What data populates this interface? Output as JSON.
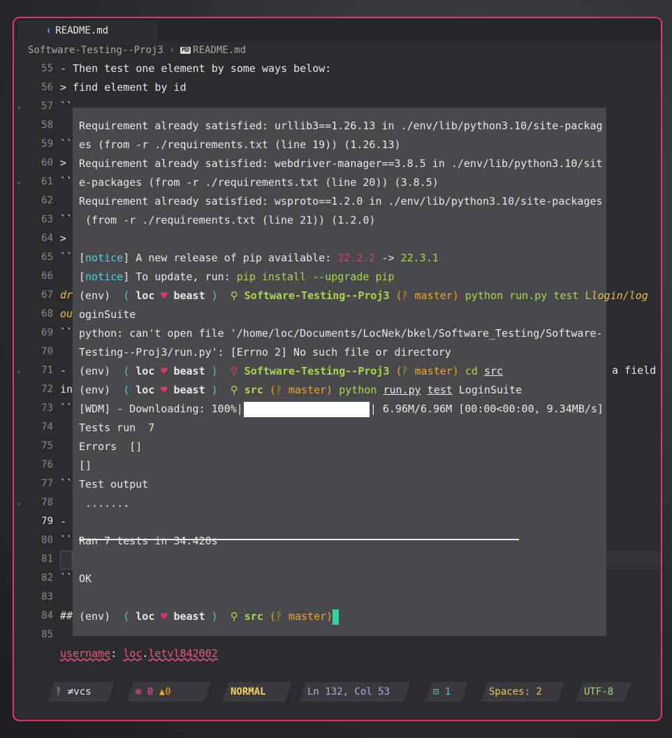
{
  "tab": {
    "label": "README.md"
  },
  "breadcrumb": {
    "folder": "Software-Testing--Proj3",
    "md_badge": "MD",
    "file": "README.md"
  },
  "gutter": [
    "55",
    "56",
    "57",
    "58",
    "59",
    "60",
    "61",
    "62",
    "63",
    "64",
    "65",
    "66",
    "67",
    "68",
    "69",
    "70",
    "71",
    "72",
    "73",
    "74",
    "75",
    "76",
    "77",
    "78",
    "79",
    "80",
    "81",
    "82",
    "83",
    "84",
    "85"
  ],
  "editor": {
    "l55": "- Then test one element by some ways below:",
    "l56": "> find element by id",
    "l57": "``",
    "l59": "``",
    "l60": ">",
    "l61": "``",
    "l63": "``",
    "l64": ">",
    "l65": "``",
    "l67": "dr",
    "l67b": "ou",
    "l68": "``",
    "l70": "-",
    "l70_right": "a field",
    "l70b": "in",
    "l71": "``",
    "l75": "``",
    "l77": "-",
    "l78": "``",
    "l80": "``",
    "l82": "##",
    "l84_key": "username",
    "l84_colon": ": ",
    "l84_val1": "loc",
    "l84_dot": ".",
    "l84_val2": "letvl842002"
  },
  "terminal": {
    "req1a": "Requirement already satisfied: urllib3==1.26.13 in ./env/lib/python3.10/site-packag",
    "req1b": "es (from -r ./requirements.txt (line 19)) (1.26.13)",
    "req2a": "Requirement already satisfied: webdriver-manager==3.8.5 in ./env/lib/python3.10/sit",
    "req2b": "e-packages (from -r ./requirements.txt (line 20)) (3.8.5)",
    "req3a": "Requirement already satisfied: wsproto==1.2.0 in ./env/lib/python3.10/site-packages",
    "req3b": " (from -r ./requirements.txt (line 21)) (1.2.0)",
    "notice_tag": "notice",
    "notice1_pre": "A new release of pip available: ",
    "notice1_old": "22.2.2",
    "notice1_arrow": " -> ",
    "notice1_new": "22.3.1",
    "notice2_pre": "To update, run: ",
    "notice2_cmd": "pip install --upgrade pip",
    "prompt_env": "(env)",
    "prompt_user": "loc",
    "prompt_host": "beast",
    "prompt_dir1": "Software-Testing--Proj3",
    "prompt_dir2": "src",
    "prompt_branch": "master",
    "cmd1": "python run.py test L",
    "cmd1_ghost": "login/log",
    "cmd1b": "oginSuite",
    "err1": "python: can't open file '/home/loc/Documents/LocNek/bkel/Software_Testing/Software-",
    "err2": "Testing--Proj3/run.py': [Errno 2] No such file or directory",
    "cmd2_cd": "cd",
    "cmd2_arg": "src",
    "cmd3_py": "python",
    "cmd3_file": "run.py",
    "cmd3_test": "test",
    "cmd3_suite": "LoginSuite",
    "wdm_pre": "[WDM] - Downloading: 100%|",
    "wdm_post": "| 6.96M/6.96M [00:00<00:00, 9.34MB/s]",
    "tests_run": "Tests run  7",
    "errors": "Errors  []",
    "brackets": "[]",
    "test_output": "Test output",
    "dots": " .......",
    "ran": "Ran 7 tests in 34.420s",
    "ok": "OK"
  },
  "status": {
    "vcs": "≠vcs",
    "errors": "0",
    "warnings": "0",
    "mode": "NORMAL",
    "position": "Ln 132, Col 53",
    "terminals": "1",
    "spaces": "Spaces: 2",
    "encoding": "UTF-8"
  },
  "colors": {
    "border": "#e0386a",
    "terminal_bg": "#49494b",
    "cursor": "#3ec9a7",
    "mode": "#f2d06a"
  }
}
